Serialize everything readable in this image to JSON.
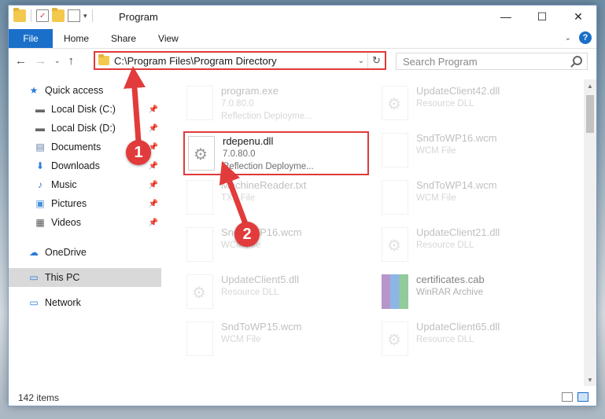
{
  "window": {
    "title": "Program",
    "controls": {
      "minimize": "—",
      "maximize": "☐",
      "close": "✕"
    }
  },
  "ribbon": {
    "tabs": [
      {
        "label": "File"
      },
      {
        "label": "Home"
      },
      {
        "label": "Share"
      },
      {
        "label": "View"
      }
    ],
    "help": "?"
  },
  "nav": {
    "address": "C:\\Program Files\\Program Directory",
    "search_placeholder": "Search Program"
  },
  "sidebar": {
    "items": [
      {
        "label": "Quick access",
        "icon": "star-icon"
      },
      {
        "label": "Local Disk (C:)",
        "icon": "drive-icon",
        "pinned": true
      },
      {
        "label": "Local Disk (D:)",
        "icon": "drive-icon",
        "pinned": true
      },
      {
        "label": "Documents",
        "icon": "documents-icon",
        "pinned": true
      },
      {
        "label": "Downloads",
        "icon": "download-icon",
        "pinned": true
      },
      {
        "label": "Music",
        "icon": "music-icon",
        "pinned": true
      },
      {
        "label": "Pictures",
        "icon": "pictures-icon",
        "pinned": true
      },
      {
        "label": "Videos",
        "icon": "videos-icon",
        "pinned": true
      },
      {
        "label": "OneDrive",
        "icon": "cloud-icon"
      },
      {
        "label": "This PC",
        "icon": "computer-icon",
        "selected": true
      },
      {
        "label": "Network",
        "icon": "network-icon"
      }
    ]
  },
  "files": {
    "left": [
      {
        "name": "program.exe",
        "line1": "7.0.80.0",
        "line2": "Reflection Deployme..."
      },
      {
        "name": "rdepenu.dll",
        "line1": "7.0.80.0",
        "line2": "Reflection Deployme..."
      },
      {
        "name": "MachineReader.txt",
        "line1": "TXT File",
        "line2": ""
      },
      {
        "name": "SndToWP16.wcm",
        "line1": "WCM File",
        "line2": ""
      },
      {
        "name": "UpdateClient5.dll",
        "line1": "Resource DLL",
        "line2": ""
      },
      {
        "name": "SndToWP15.wcm",
        "line1": "WCM File",
        "line2": ""
      }
    ],
    "right": [
      {
        "name": "UpdateClient42.dll",
        "line1": "Resource DLL"
      },
      {
        "name": "SndToWP16.wcm",
        "line1": "WCM File"
      },
      {
        "name": "SndToWP14.wcm",
        "line1": "WCM File"
      },
      {
        "name": "UpdateClient21.dll",
        "line1": "Resource DLL"
      },
      {
        "name": "certificates.cab",
        "line1": "WinRAR Archive"
      },
      {
        "name": "UpdateClient65.dll",
        "line1": "Resource DLL"
      }
    ]
  },
  "status": {
    "count": "142 items"
  },
  "annotations": {
    "step1": "1",
    "step2": "2",
    "color": "#e23b3b"
  }
}
